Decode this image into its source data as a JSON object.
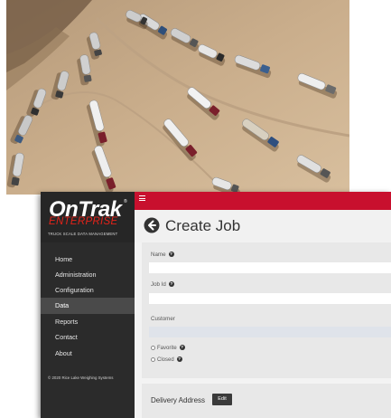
{
  "photo": {
    "description_icon": "aerial-truck-queue-photo"
  },
  "app": {
    "logo": {
      "main": "OnTrak",
      "sub": "ENTERPRISE",
      "tagline": "TRUCK SCALE DATA MANAGEMENT",
      "tm": "®"
    },
    "sidebar": {
      "items": [
        {
          "label": "Home",
          "active": false
        },
        {
          "label": "Administration",
          "active": false
        },
        {
          "label": "Configuration",
          "active": false
        },
        {
          "label": "Data",
          "active": true
        },
        {
          "label": "Reports",
          "active": false
        },
        {
          "label": "Contact",
          "active": false
        },
        {
          "label": "About",
          "active": false
        }
      ],
      "footer": "© 2020 Rice Lake Weighing Systems"
    },
    "topbar": {
      "menu_icon": "hamburger-icon",
      "color": "#c8102e"
    },
    "header": {
      "back_icon": "arrow-left-circle-icon",
      "title": "Create Job"
    },
    "form": {
      "name_label": "Name",
      "name_value": "",
      "jobid_label": "Job Id",
      "jobid_value": "",
      "customer_label": "Customer",
      "customer_value": "",
      "favorite_label": "Favorite",
      "closed_label": "Closed",
      "help_glyph": "?"
    },
    "delivery": {
      "label": "Delivery Address",
      "edit_label": "Edit"
    }
  }
}
